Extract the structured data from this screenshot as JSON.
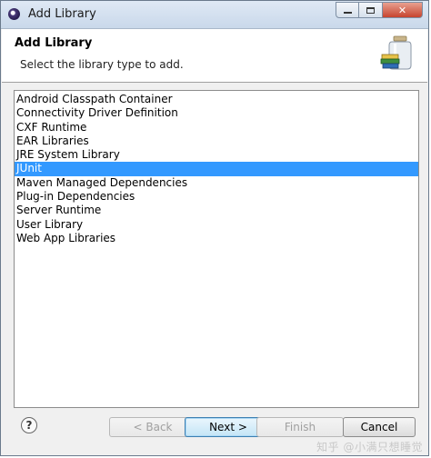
{
  "window": {
    "title": "Add Library"
  },
  "header": {
    "title": "Add Library",
    "description": "Select the library type to add."
  },
  "library_types": [
    {
      "label": "Android Classpath Container",
      "selected": false
    },
    {
      "label": "Connectivity Driver Definition",
      "selected": false
    },
    {
      "label": "CXF Runtime",
      "selected": false
    },
    {
      "label": "EAR Libraries",
      "selected": false
    },
    {
      "label": "JRE System Library",
      "selected": false
    },
    {
      "label": "JUnit",
      "selected": true
    },
    {
      "label": "Maven Managed Dependencies",
      "selected": false
    },
    {
      "label": "Plug-in Dependencies",
      "selected": false
    },
    {
      "label": "Server Runtime",
      "selected": false
    },
    {
      "label": "User Library",
      "selected": false
    },
    {
      "label": "Web App Libraries",
      "selected": false
    }
  ],
  "buttons": {
    "help": "?",
    "back": "< Back",
    "next": "Next >",
    "finish": "Finish",
    "cancel": "Cancel"
  },
  "watermark": "知乎 @小满只想睡觉",
  "colors": {
    "selection": "#3399ff",
    "selection_text": "#ffffff"
  }
}
